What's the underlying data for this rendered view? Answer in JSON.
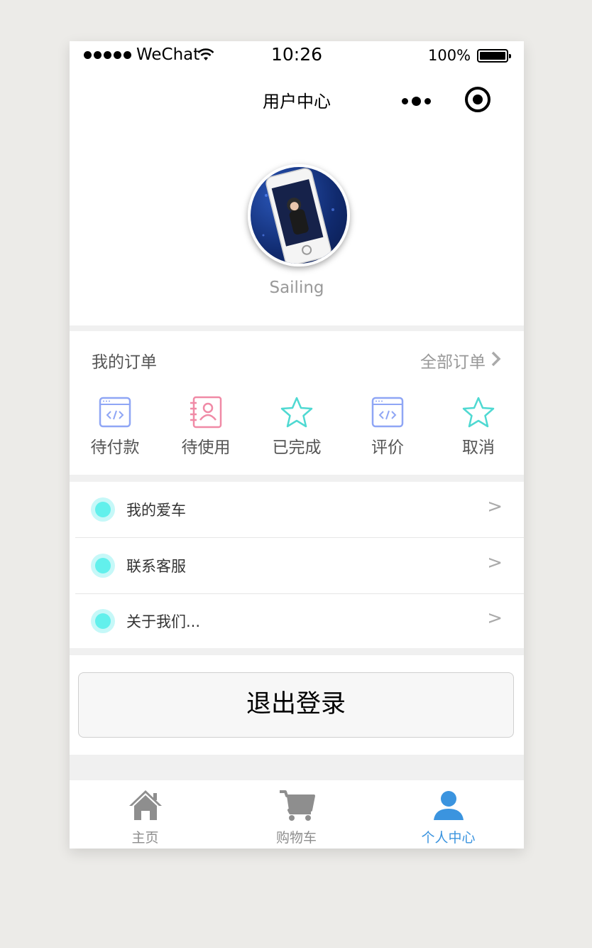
{
  "status_bar": {
    "carrier": "WeChat",
    "time": "10:26",
    "battery": "100%"
  },
  "nav": {
    "title": "用户中心"
  },
  "profile": {
    "nickname": "Sailing"
  },
  "orders": {
    "title": "我的订单",
    "all_link": "全部订单",
    "items": [
      {
        "label": "待付款",
        "icon": "code-window-icon",
        "color": "#8fa6f5"
      },
      {
        "label": "待使用",
        "icon": "contact-card-icon",
        "color": "#f08aa6"
      },
      {
        "label": "已完成",
        "icon": "star-icon",
        "color": "#4fd9d2"
      },
      {
        "label": "评价",
        "icon": "code-window-icon",
        "color": "#8fa6f5"
      },
      {
        "label": "取消",
        "icon": "star-icon",
        "color": "#4fd9d2"
      }
    ]
  },
  "menu": {
    "items": [
      {
        "label": "我的爱车",
        "arrow": ">"
      },
      {
        "label": "联系客服",
        "arrow": ">"
      },
      {
        "label": "关于我们...",
        "arrow": ">"
      }
    ]
  },
  "logout": {
    "label": "退出登录"
  },
  "tabbar": {
    "items": [
      {
        "label": "主页",
        "icon": "home-icon"
      },
      {
        "label": "购物车",
        "icon": "cart-icon"
      },
      {
        "label": "个人中心",
        "icon": "person-icon",
        "active": true
      }
    ]
  },
  "colors": {
    "accent": "#3b94df",
    "menu_dot": "#62f0ec"
  }
}
